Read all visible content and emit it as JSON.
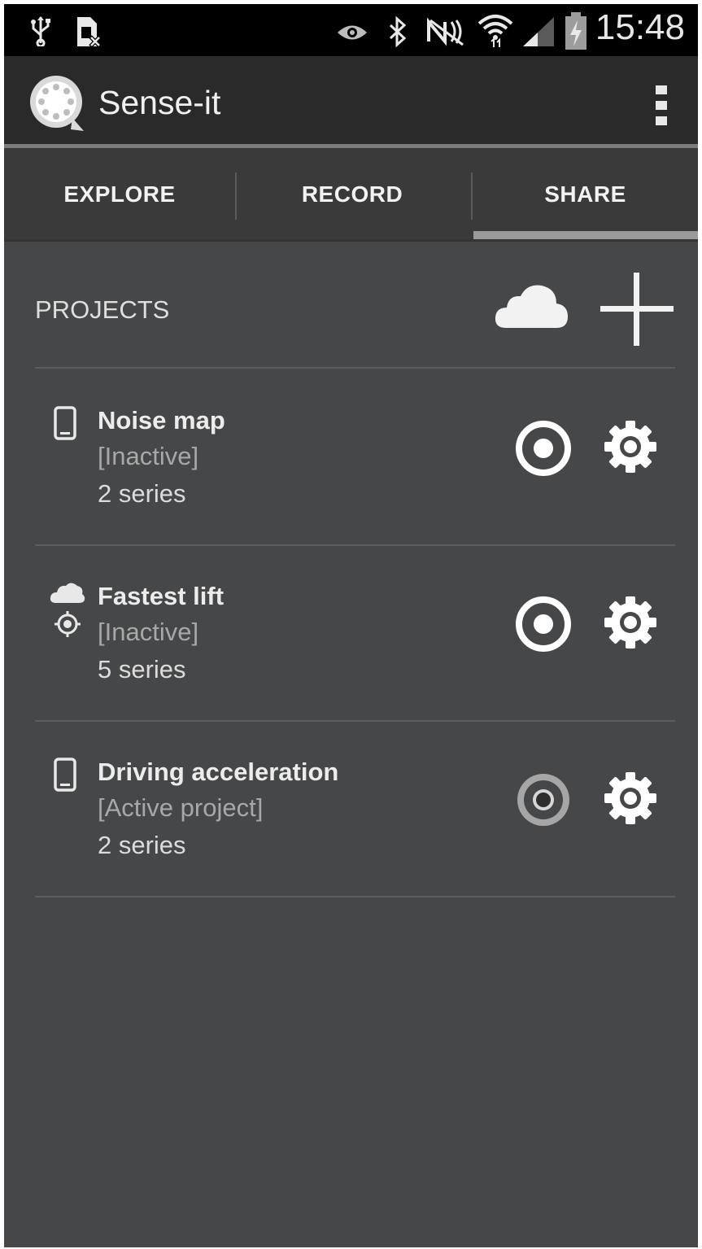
{
  "status_bar": {
    "time": "15:48",
    "icons": [
      "usb-icon",
      "sim-icon",
      "eye-icon",
      "bluetooth-icon",
      "nfc-icon",
      "wifi-icon",
      "signal-icon",
      "battery-icon"
    ]
  },
  "app_bar": {
    "title": "Sense-it",
    "logo": "sense-it-logo-icon",
    "menu_icon": "overflow-menu-icon"
  },
  "tabs": [
    {
      "label": "EXPLORE",
      "selected": false
    },
    {
      "label": "RECORD",
      "selected": false
    },
    {
      "label": "SHARE",
      "selected": true
    }
  ],
  "projects_header": {
    "label": "PROJECTS",
    "cloud_icon": "cloud-icon",
    "add_icon": "plus-icon"
  },
  "projects": [
    {
      "name": "Noise map",
      "status": "[Inactive]",
      "series": "2 series",
      "type_icon": "phone-icon",
      "record_state": "inactive"
    },
    {
      "name": "Fastest lift",
      "status": "[Inactive]",
      "series": "5 series",
      "type_icon": "cloud-location-icon",
      "record_state": "inactive"
    },
    {
      "name": "Driving acceleration",
      "status": "[Active project]",
      "series": "2 series",
      "type_icon": "phone-icon",
      "record_state": "active"
    }
  ],
  "colors": {
    "background": "#464748",
    "status_bar": "#000000",
    "action_bar": "#2a2a2a",
    "tabs": "#3a3a3a",
    "tab_indicator": "#9a9a9a",
    "text_primary": "#ececec",
    "text_secondary": "#a8a8a8"
  }
}
